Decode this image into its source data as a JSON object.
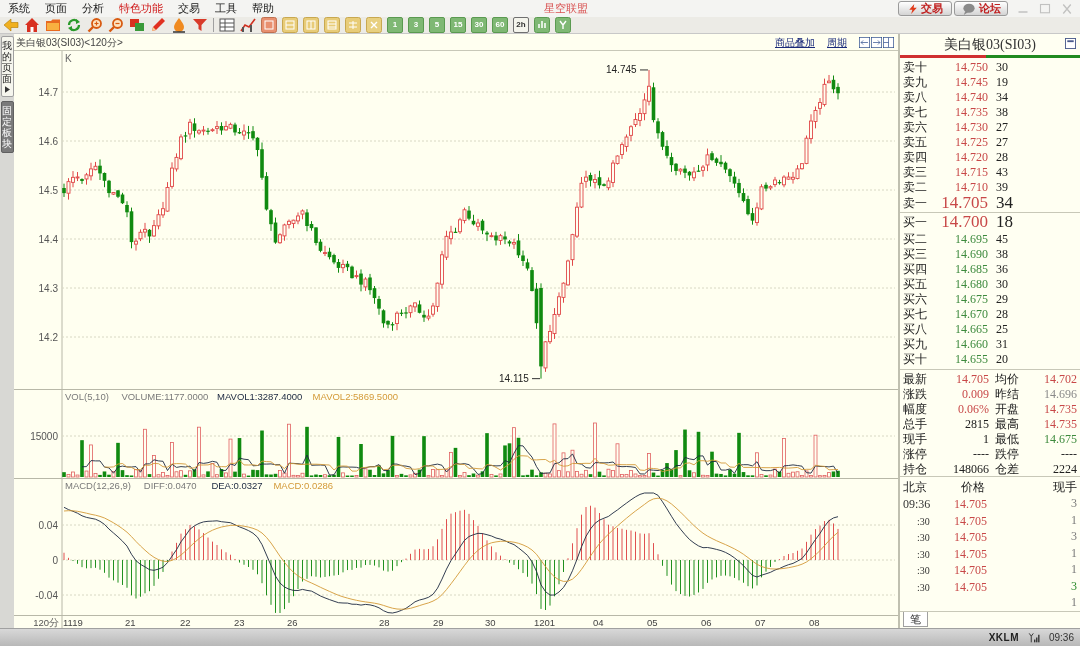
{
  "menu_bar": {
    "items": [
      {
        "label": "系统",
        "highlighted": false
      },
      {
        "label": "页面",
        "highlighted": false
      },
      {
        "label": "分析",
        "highlighted": false
      },
      {
        "label": "特色功能",
        "highlighted": true
      },
      {
        "label": "交易",
        "highlighted": false
      },
      {
        "label": "工具",
        "highlighted": false
      },
      {
        "label": "帮助",
        "highlighted": false
      }
    ],
    "title": "星空联盟",
    "buttons": [
      {
        "kind": "trade",
        "label": "交易"
      },
      {
        "kind": "forum",
        "label": "论坛"
      }
    ]
  },
  "toolbar": {
    "period_buttons": [
      {
        "label": "1",
        "selected": false
      },
      {
        "label": "3",
        "selected": false
      },
      {
        "label": "5",
        "selected": false
      },
      {
        "label": "15",
        "selected": false
      },
      {
        "label": "30",
        "selected": false
      },
      {
        "label": "60",
        "selected": false
      },
      {
        "label": "2h",
        "selected": true
      }
    ]
  },
  "side_tabs": [
    {
      "label": "我的页面",
      "selected": true
    },
    {
      "label": "固定板块",
      "selected": false
    }
  ],
  "chart": {
    "title": "美白银03(SI03)<120分>",
    "links": [
      "商品叠加",
      "周期"
    ],
    "panel_label": "K",
    "y_labels": [
      "14.7",
      "14.6",
      "14.5",
      "14.4",
      "14.3",
      "14.2"
    ],
    "high_label": "14.745",
    "low_label": "14.115",
    "volume": {
      "legend": [
        "VOL(5,10)",
        "VOLUME:1177.0000",
        "MAVOL1:3287.4000",
        "MAVOL2:5869.5000"
      ],
      "y_label": "15000"
    },
    "macd": {
      "legend": [
        "MACD(12,26,9)",
        "DIFF:0.0470",
        "DEA:0.0327",
        "MACD:0.0286"
      ],
      "y_labels": [
        "0.04",
        "0",
        "-0.04"
      ]
    },
    "x_axis": {
      "period": "120分",
      "labels": [
        "1119",
        "21",
        "22",
        "23",
        "26",
        "28",
        "29",
        "30",
        "1201",
        "04",
        "05",
        "06",
        "07",
        "08"
      ]
    }
  },
  "quote_panel": {
    "title": "美白银03(SI03)",
    "asks": [
      {
        "label": "卖十",
        "price": "14.750",
        "volume": "30",
        "kind": "up",
        "best": false
      },
      {
        "label": "卖九",
        "price": "14.745",
        "volume": "19",
        "kind": "up",
        "best": false
      },
      {
        "label": "卖八",
        "price": "14.740",
        "volume": "34",
        "kind": "up",
        "best": false
      },
      {
        "label": "卖七",
        "price": "14.735",
        "volume": "38",
        "kind": "up",
        "best": false
      },
      {
        "label": "卖六",
        "price": "14.730",
        "volume": "27",
        "kind": "up",
        "best": false
      },
      {
        "label": "卖五",
        "price": "14.725",
        "volume": "27",
        "kind": "up",
        "best": false
      },
      {
        "label": "卖四",
        "price": "14.720",
        "volume": "28",
        "kind": "up",
        "best": false
      },
      {
        "label": "卖三",
        "price": "14.715",
        "volume": "43",
        "kind": "up",
        "best": false
      },
      {
        "label": "卖二",
        "price": "14.710",
        "volume": "39",
        "kind": "up",
        "best": false
      },
      {
        "label": "卖一",
        "price": "14.705",
        "volume": "34",
        "kind": "up",
        "best": true
      }
    ],
    "bids": [
      {
        "label": "买一",
        "price": "14.700",
        "volume": "18",
        "kind": "up",
        "best": true
      },
      {
        "label": "买二",
        "price": "14.695",
        "volume": "45",
        "kind": "down",
        "best": false
      },
      {
        "label": "买三",
        "price": "14.690",
        "volume": "38",
        "kind": "down",
        "best": false
      },
      {
        "label": "买四",
        "price": "14.685",
        "volume": "36",
        "kind": "down",
        "best": false
      },
      {
        "label": "买五",
        "price": "14.680",
        "volume": "30",
        "kind": "down",
        "best": false
      },
      {
        "label": "买六",
        "price": "14.675",
        "volume": "29",
        "kind": "down",
        "best": false
      },
      {
        "label": "买七",
        "price": "14.670",
        "volume": "28",
        "kind": "down",
        "best": false
      },
      {
        "label": "买八",
        "price": "14.665",
        "volume": "25",
        "kind": "down",
        "best": false
      },
      {
        "label": "买九",
        "price": "14.660",
        "volume": "31",
        "kind": "down",
        "best": false
      },
      {
        "label": "买十",
        "price": "14.655",
        "volume": "20",
        "kind": "down",
        "best": false
      }
    ],
    "stats": [
      {
        "cells": [
          {
            "label": "最新",
            "value": "14.705",
            "kind": "up"
          },
          {
            "label": "均价",
            "value": "14.702",
            "kind": "up"
          }
        ]
      },
      {
        "cells": [
          {
            "label": "涨跌",
            "value": "0.009",
            "kind": "up"
          },
          {
            "label": "昨结",
            "value": "14.696",
            "kind": "reference"
          }
        ]
      },
      {
        "cells": [
          {
            "label": "幅度",
            "value": "0.06%",
            "kind": "up"
          },
          {
            "label": "开盘",
            "value": "14.735",
            "kind": "up"
          }
        ]
      },
      {
        "cells": [
          {
            "label": "总手",
            "value": "2815",
            "kind": "plain"
          },
          {
            "label": "最高",
            "value": "14.735",
            "kind": "up"
          }
        ]
      },
      {
        "cells": [
          {
            "label": "现手",
            "value": "1",
            "kind": "plain"
          },
          {
            "label": "最低",
            "value": "14.675",
            "kind": "down"
          }
        ]
      },
      {
        "cells": [
          {
            "label": "涨停",
            "value": "----",
            "kind": "plain"
          },
          {
            "label": "跌停",
            "value": "----",
            "kind": "plain"
          }
        ]
      },
      {
        "cells": [
          {
            "label": "持仓",
            "value": "148066",
            "kind": "plain"
          },
          {
            "label": "仓差",
            "value": "2224",
            "kind": "plain"
          }
        ]
      }
    ],
    "trades": {
      "columns": [
        "北京",
        "价格",
        "现手"
      ],
      "rows": [
        {
          "kind": "minute",
          "time": "09:36",
          "price": "14.705",
          "volume": "3",
          "falling": false
        },
        {
          "kind": "second",
          "time": ":30",
          "price": "14.705",
          "volume": "1",
          "falling": false
        },
        {
          "kind": "second",
          "time": ":30",
          "price": "14.705",
          "volume": "3",
          "falling": false
        },
        {
          "kind": "second",
          "time": ":30",
          "price": "14.705",
          "volume": "1",
          "falling": false
        },
        {
          "kind": "second",
          "time": ":30",
          "price": "14.705",
          "volume": "1",
          "falling": false
        },
        {
          "kind": "second",
          "time": ":30",
          "price": "14.705",
          "volume": "3",
          "falling": true
        },
        {
          "volume": "1",
          "falling": false
        }
      ]
    },
    "tab": "笔"
  },
  "status_bar": {
    "server": "XKLM",
    "time": "09:36"
  }
}
